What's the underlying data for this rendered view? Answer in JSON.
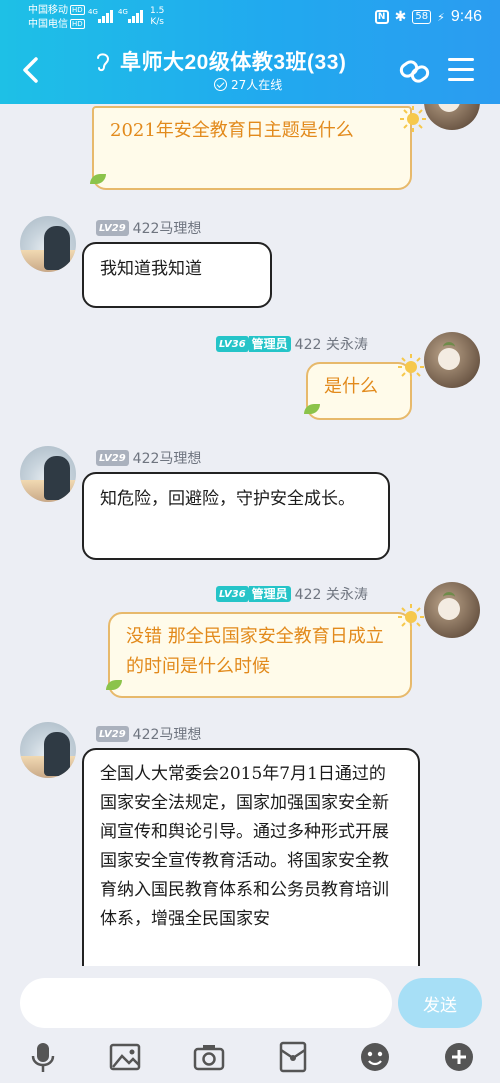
{
  "status": {
    "carrier1": "中国移动",
    "carrier2": "中国电信",
    "hd": "HD",
    "net1": "4G",
    "net2": "4G",
    "speed_value": "1.5",
    "speed_unit": "K/s",
    "battery": "58",
    "time": "9:46"
  },
  "header": {
    "title": "阜师大20级体教3班(33)",
    "online": "27人在线"
  },
  "messages": [
    {
      "text": "2021年安全教育日主题是什么"
    },
    {
      "level": "LV29",
      "name": "422马理想",
      "text": "我知道我知道"
    },
    {
      "level": "LV36",
      "role": "管理员",
      "name": "422  关永涛",
      "text": "是什么"
    },
    {
      "level": "LV29",
      "name": "422马理想",
      "text": "知危险，回避险，守护安全成长。"
    },
    {
      "level": "LV36",
      "role": "管理员",
      "name": "422  关永涛",
      "text": "没错 那全民国家安全教育日成立的时间是什么时候"
    },
    {
      "level": "LV29",
      "name": "422马理想",
      "text": "全国人大常委会2015年7月1日通过的国家安全法规定，国家加强国家安全新闻宣传和舆论引导。通过多种形式开展国家安全宣传教育活动。将国家安全教育纳入国民教育体系和公务员教育培训体系，增强全民国家安"
    }
  ],
  "input": {
    "placeholder": "",
    "send_label": "发送"
  },
  "toolbar": [
    "mic-icon",
    "image-icon",
    "camera-icon",
    "red-packet-icon",
    "emoji-icon",
    "plus-icon"
  ],
  "colors": {
    "header_start": "#1ec0e6",
    "header_end": "#2b9cf0",
    "gold_text": "#e28a1c",
    "send_bg": "#a7dff6"
  }
}
